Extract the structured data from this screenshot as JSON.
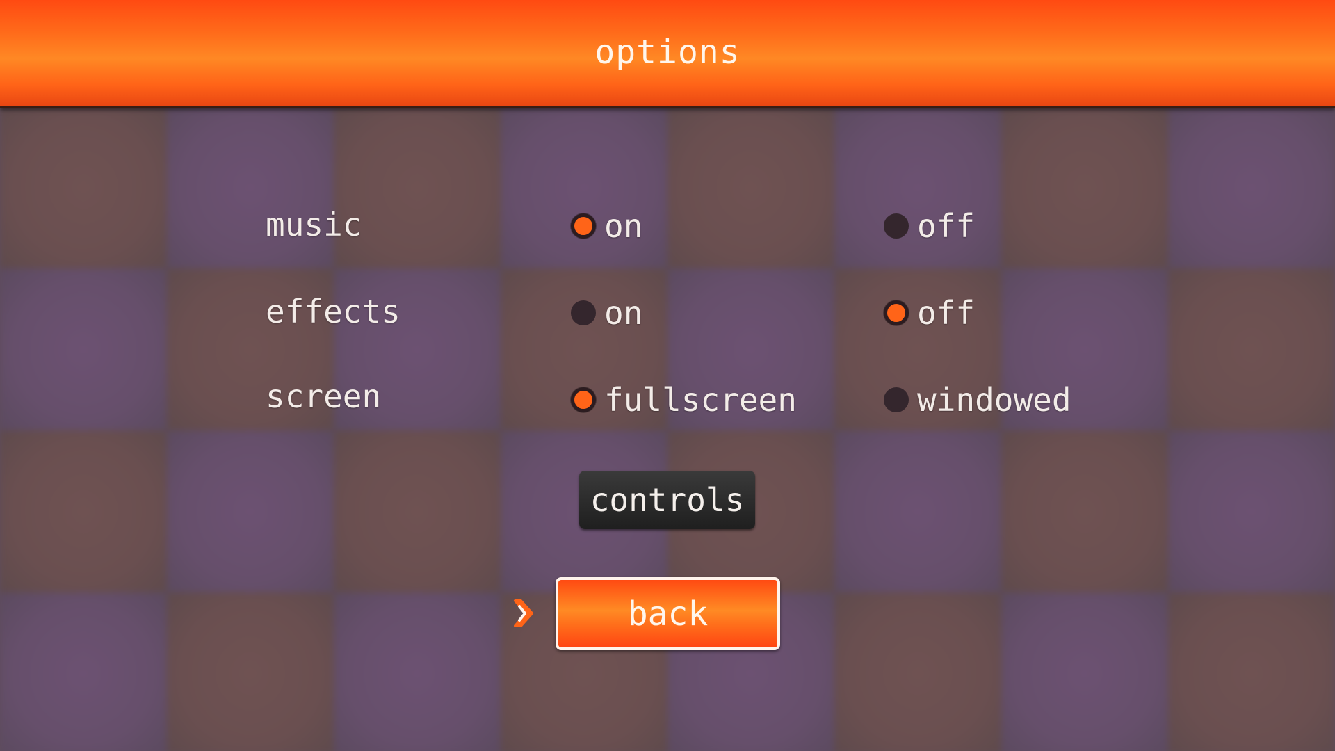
{
  "header": {
    "title": "options"
  },
  "settings": [
    {
      "label": "music",
      "options": [
        {
          "label": "on",
          "selected": true
        },
        {
          "label": "off",
          "selected": false
        }
      ]
    },
    {
      "label": "effects",
      "options": [
        {
          "label": "on",
          "selected": false
        },
        {
          "label": "off",
          "selected": true
        }
      ]
    },
    {
      "label": "screen",
      "options": [
        {
          "label": "fullscreen",
          "selected": true
        },
        {
          "label": "windowed",
          "selected": false
        }
      ]
    }
  ],
  "buttons": {
    "controls_label": "controls",
    "back_label": "back",
    "focused": "back"
  },
  "icons": {
    "cursor": "chevron-right-icon"
  },
  "colors": {
    "accent": "#ff6418",
    "radio_unselected": "#34262d",
    "tile_brown": "#6a4f50",
    "tile_purple": "#664f6b",
    "button_dark": "#2a2a2a",
    "text": "#f3ece8"
  }
}
